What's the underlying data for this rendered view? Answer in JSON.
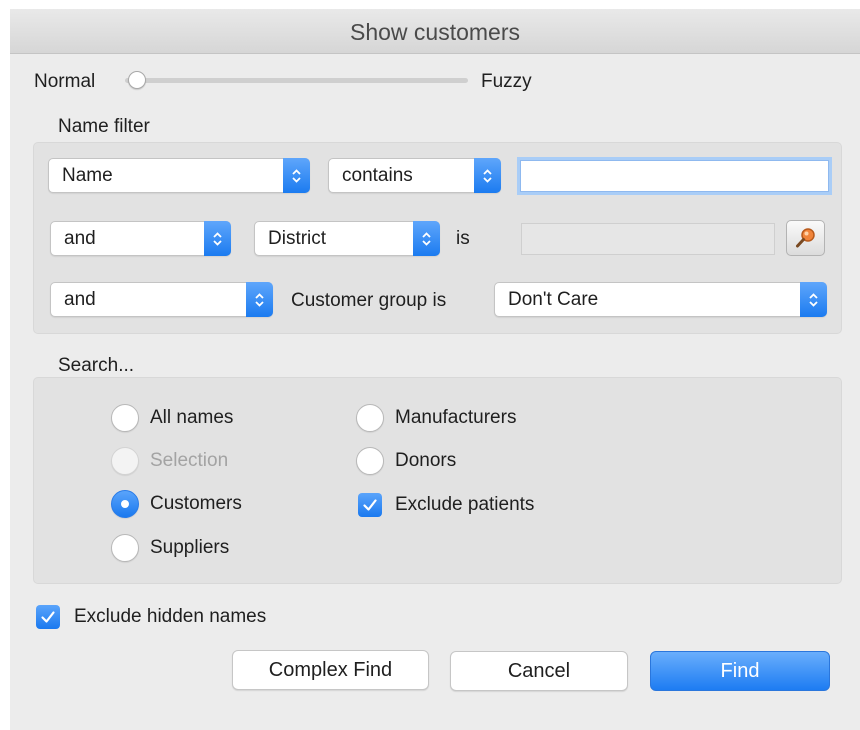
{
  "window": {
    "title": "Show customers"
  },
  "slider": {
    "left_label": "Normal",
    "right_label": "Fuzzy",
    "value": 0
  },
  "name_filter": {
    "heading": "Name filter",
    "row1": {
      "field": "Name",
      "operator": "contains",
      "value": ""
    },
    "row2": {
      "conjunction": "and",
      "field": "District",
      "is_label": "is",
      "value": "",
      "lookup_icon": "magnifier-icon"
    },
    "row3": {
      "conjunction": "and",
      "label": "Customer group is",
      "group": "Don't Care"
    }
  },
  "search": {
    "heading": "Search...",
    "options": {
      "all_names": "All names",
      "selection": "Selection",
      "customers": "Customers",
      "suppliers": "Suppliers",
      "manufacturers": "Manufacturers",
      "donors": "Donors"
    },
    "selected": "Customers",
    "exclude_patients": {
      "label": "Exclude patients",
      "checked": true
    }
  },
  "exclude_hidden": {
    "label": "Exclude hidden names",
    "checked": true
  },
  "buttons": {
    "complex_find": "Complex Find",
    "cancel": "Cancel",
    "find": "Find"
  },
  "colors": {
    "accent": "#1b7bf0",
    "window_bg": "#ececec",
    "group_bg": "#e2e2e2"
  }
}
